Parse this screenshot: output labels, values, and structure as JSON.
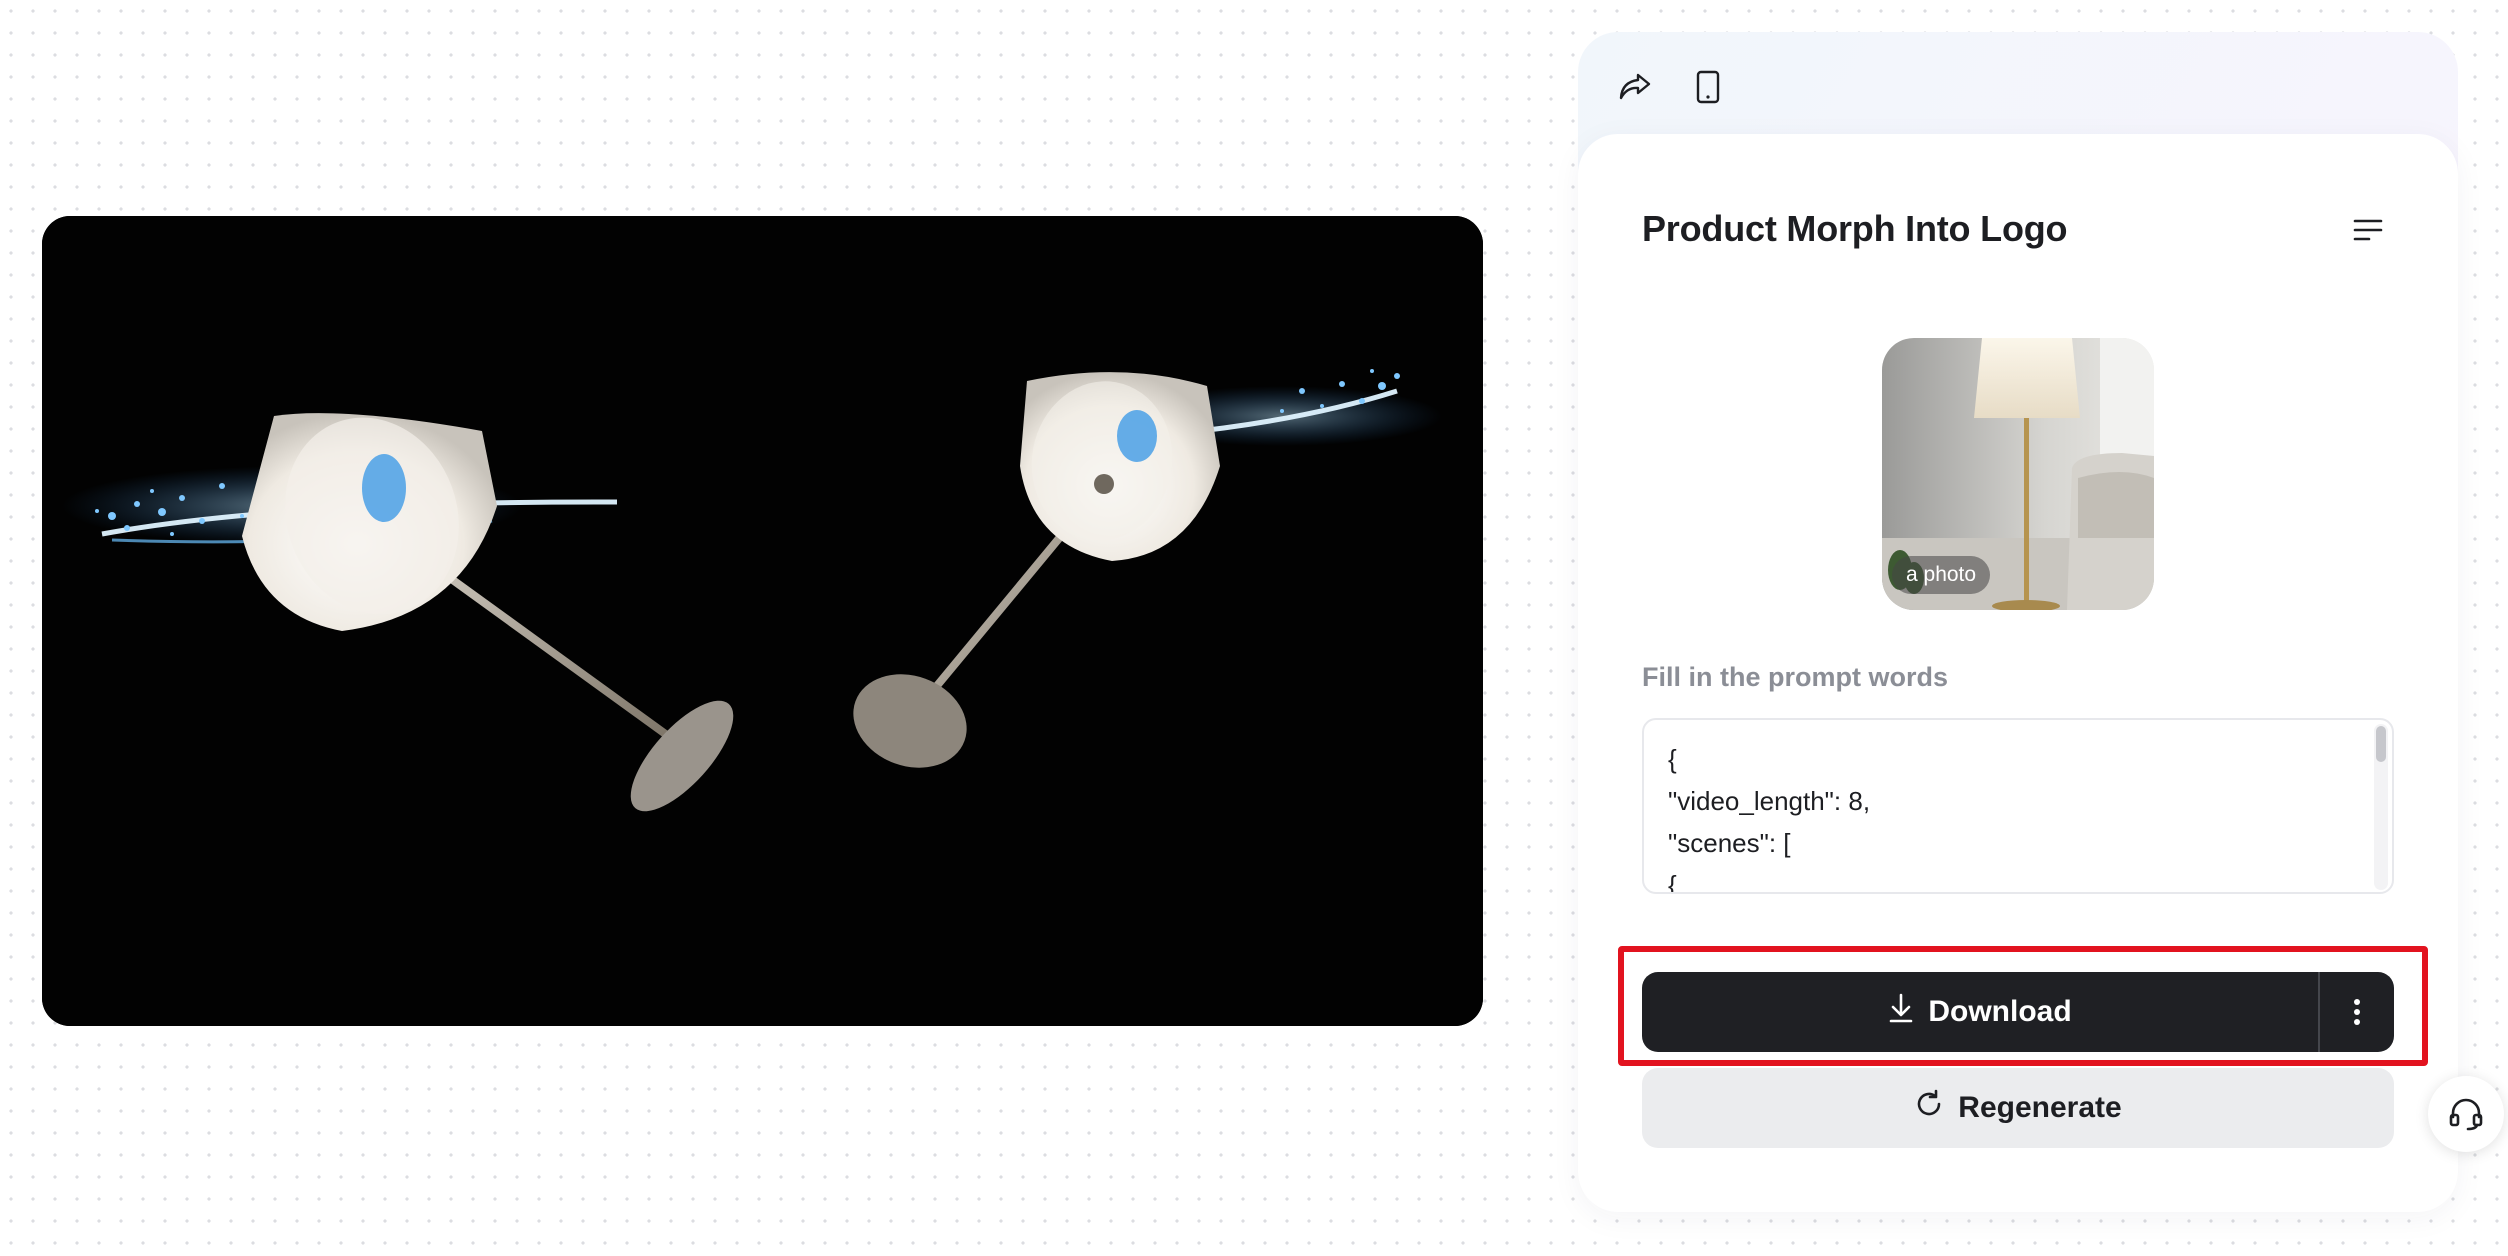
{
  "preview": {
    "content": "lamp-morph-video-frame"
  },
  "toolbar": {
    "share_icon": "share-icon",
    "mobile_icon": "mobile-device-icon"
  },
  "panel": {
    "title": "Product Morph Into Logo",
    "menu_icon": "menu-icon",
    "reference_image": {
      "badge": "a photo"
    },
    "prompt": {
      "label": "Fill in the prompt words",
      "value": "{\n\"video_length\": 8,\n\"scenes\": [\n{"
    },
    "actions": {
      "download_label": "Download",
      "more_icon": "more-vertical-icon",
      "regenerate_label": "Regenerate"
    }
  },
  "support_icon": "headset-icon",
  "colors": {
    "primary_button": "#1f2024",
    "secondary_button": "#ebecee",
    "highlight": "#e2131f",
    "label_gray": "#8b8e96"
  }
}
